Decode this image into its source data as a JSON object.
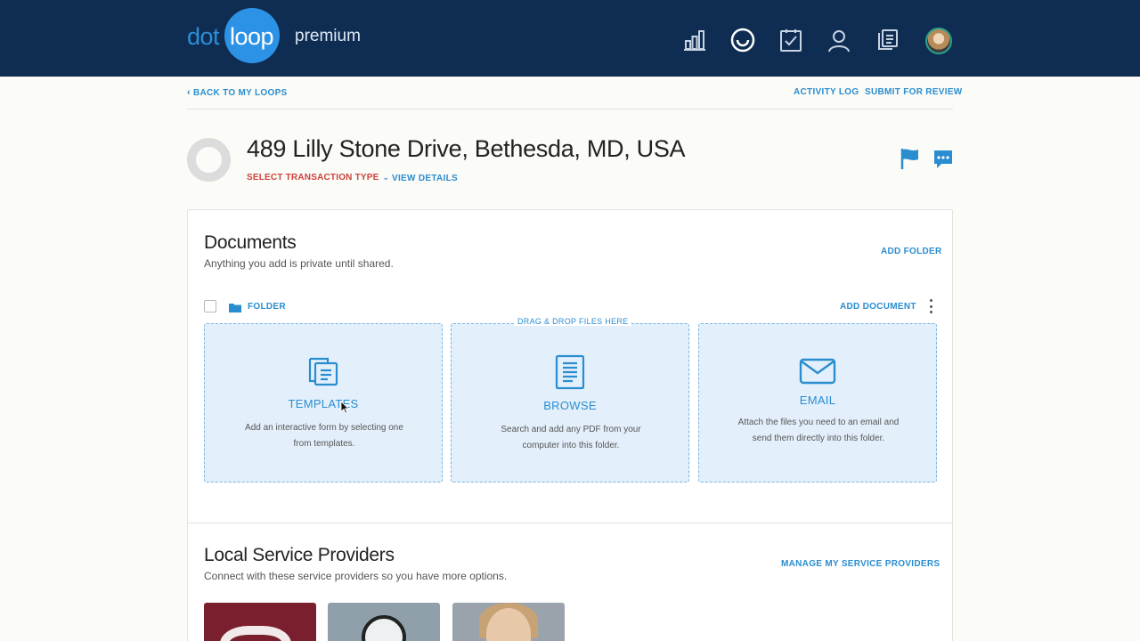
{
  "header": {
    "logo_dot": "dot",
    "logo_loop": "loop",
    "logo_tier": "premium",
    "nav_icons": [
      "bar-chart-icon",
      "loop-icon",
      "tasks-icon",
      "profile-icon",
      "documents-icon"
    ],
    "colors": {
      "bar": "#0f2d53",
      "logo_circle": "#2c92e6",
      "accent": "#2a8dd0"
    }
  },
  "subnav": {
    "back_label": "BACK TO MY LOOPS",
    "activity_log": "ACTIVITY LOG",
    "submit_review": "SUBMIT FOR REVIEW"
  },
  "loop": {
    "address": "489 Lilly Stone Drive, Bethesda, MD, USA",
    "transaction_type": "SELECT TRANSACTION TYPE",
    "view_details": "VIEW DETAILS",
    "status_color": "#d0423b"
  },
  "documents": {
    "title": "Documents",
    "subtitle": "Anything you add is private until shared.",
    "add_folder": "ADD FOLDER",
    "folder_label": "FOLDER",
    "add_document": "ADD DOCUMENT",
    "drop_hint": "DRAG & DROP FILES HERE",
    "tiles": [
      {
        "name": "TEMPLATES",
        "desc": "Add an interactive form by selecting one from templates.",
        "icon": "templates-icon"
      },
      {
        "name": "BROWSE",
        "desc": "Search and add any PDF from your computer into this folder.",
        "icon": "document-icon"
      },
      {
        "name": "EMAIL",
        "desc": "Attach the files you need to an email and send them directly into this folder.",
        "icon": "envelope-icon"
      }
    ]
  },
  "providers": {
    "title": "Local Service Providers",
    "subtitle": "Connect with these service providers so you have more options.",
    "manage": "MANAGE MY SERVICE PROVIDERS"
  }
}
